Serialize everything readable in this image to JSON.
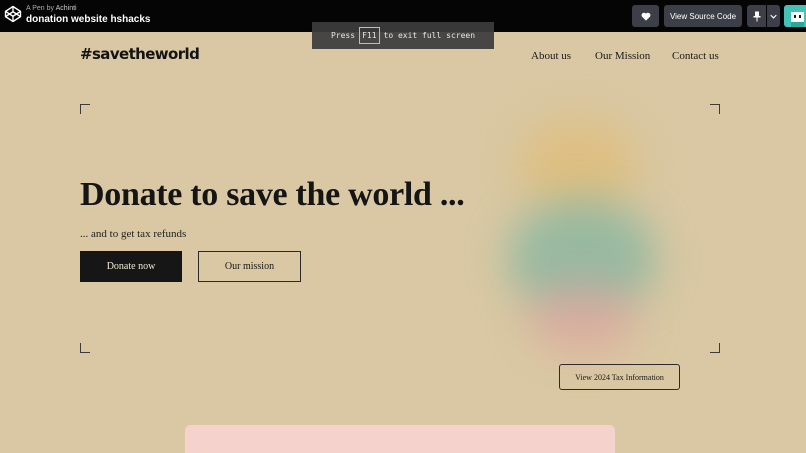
{
  "codepen": {
    "pen_by_prefix": "A Pen by",
    "author": "Achinti",
    "pen_title": "donation website hshacks",
    "view_source_label": "View Source Code"
  },
  "toast": {
    "before": "Press",
    "key": "F11",
    "after": "to exit full screen"
  },
  "site": {
    "brand": "#savetheworld",
    "nav": [
      "About us",
      "Our Mission",
      "Contact us"
    ]
  },
  "hero": {
    "title": "Donate to save the world ...",
    "subtitle": "... and to get tax refunds",
    "primary_button": "Donate now",
    "secondary_button": "Our mission",
    "tax_button": "View 2024 Tax Information"
  },
  "colors": {
    "background": "#d9c8a3",
    "topbar": "#050505",
    "button_dark": "#161616",
    "card_pink": "#f6d2cc"
  }
}
